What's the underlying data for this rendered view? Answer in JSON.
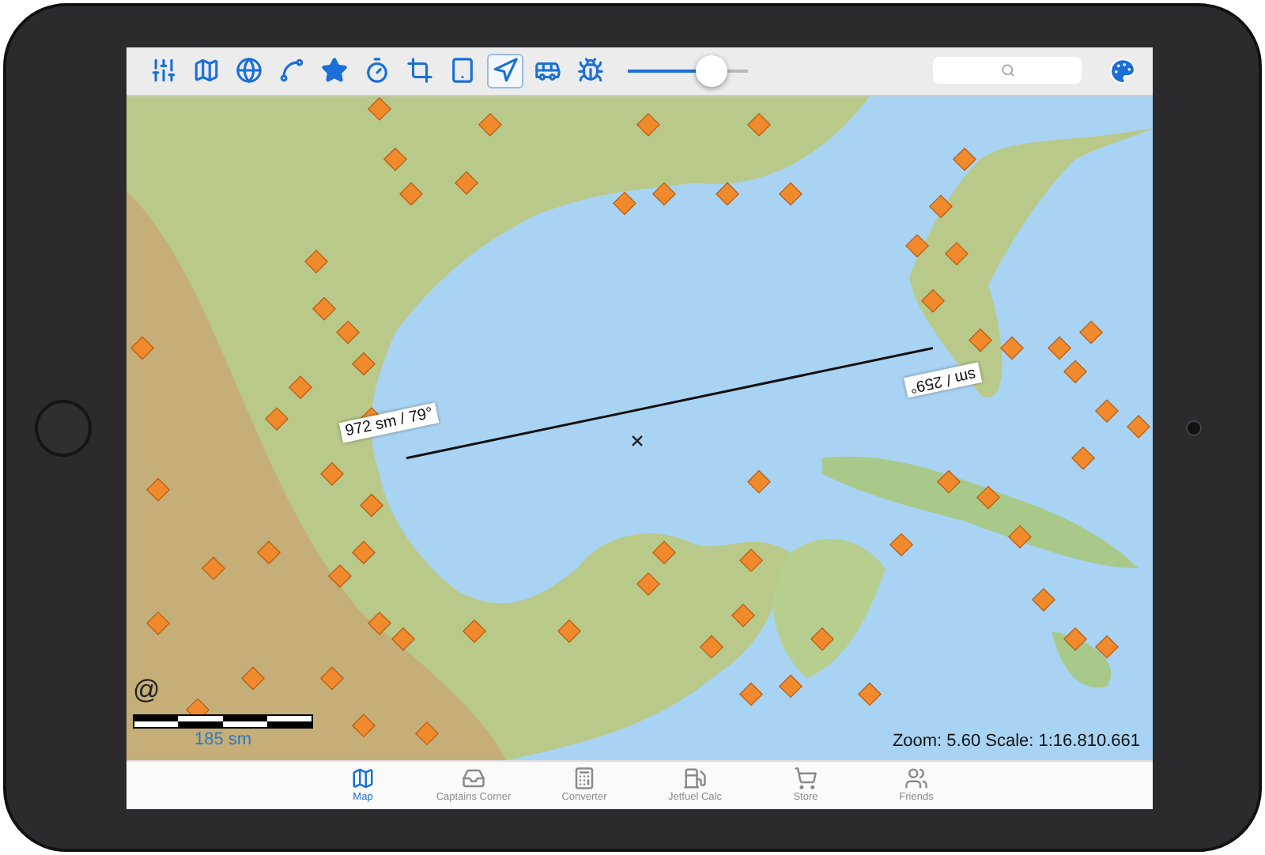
{
  "toolbar": {
    "zoom_slider": {
      "level": 0.7
    }
  },
  "map": {
    "route": {
      "outbound_label": "972 sm / 79°",
      "return_label": "sm / 259°"
    },
    "attribution": "@",
    "scale_bar": {
      "label": "185 sm"
    },
    "status": "Zoom: 5.60  Scale: 1:16.810.661"
  },
  "tabs": [
    {
      "label": "Map",
      "selected": true
    },
    {
      "label": "Captains Corner",
      "selected": false
    },
    {
      "label": "Converter",
      "selected": false
    },
    {
      "label": "Jetfuel Calc",
      "selected": false
    },
    {
      "label": "Store",
      "selected": false
    },
    {
      "label": "Friends",
      "selected": false
    }
  ]
}
